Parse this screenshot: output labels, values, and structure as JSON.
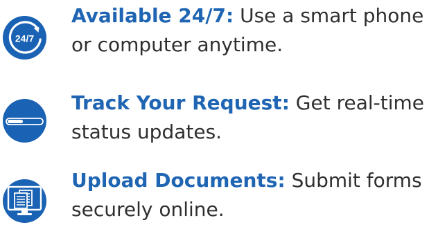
{
  "colors": {
    "accent": "#1f65b3",
    "icon_fill": "#1a62b3",
    "body_text": "#2f2f2f",
    "background": "#ffffff"
  },
  "features": [
    {
      "icon": "clock-24-7-icon",
      "icon_text": "24/7",
      "title": "Available 24/7:",
      "body_line_1": "Use a smart phone",
      "body_line_2": "or computer anytime."
    },
    {
      "icon": "progress-bar-icon",
      "progress": 0.45,
      "title": "Track Your Request:",
      "body_line_1": "Get real-time",
      "body_line_2": "status updates."
    },
    {
      "icon": "document-upload-computer-icon",
      "title": "Upload Documents:",
      "body_line_1": "Submit forms",
      "body_line_2": "securely online."
    }
  ]
}
